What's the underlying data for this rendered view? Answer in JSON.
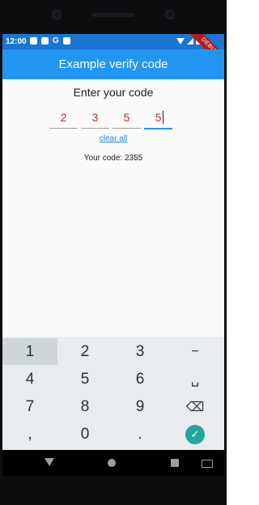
{
  "status_bar": {
    "time": "12:00",
    "g_icon": "G",
    "debug_label": "DEBUG"
  },
  "app_bar": {
    "title": "Example verify code"
  },
  "verify": {
    "prompt": "Enter your code",
    "digits": [
      "2",
      "3",
      "5",
      "5"
    ],
    "clear_label": "clear all",
    "your_code_text": "Your code: 2355"
  },
  "keyboard": {
    "keys": [
      "1",
      "2",
      "3",
      "−",
      "4",
      "5",
      "6",
      "␣",
      "7",
      "8",
      "9",
      "⌫",
      ",",
      "0",
      ".",
      "✓"
    ],
    "accent_color": "#26a69a"
  },
  "colors": {
    "app_bar": "#2196f3",
    "status_bar": "#1976d2",
    "digit_text": "#c62828",
    "link": "#1e88e5"
  }
}
